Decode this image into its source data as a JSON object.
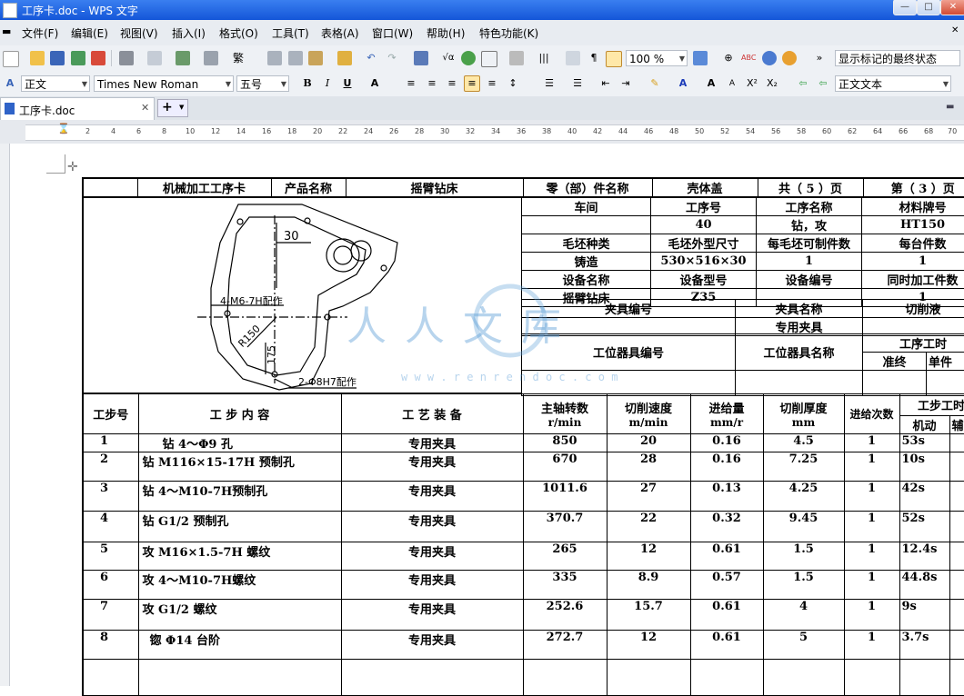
{
  "window": {
    "title": "工序卡.doc - WPS 文字"
  },
  "menu": [
    "文件(F)",
    "编辑(E)",
    "视图(V)",
    "插入(I)",
    "格式(O)",
    "工具(T)",
    "表格(A)",
    "窗口(W)",
    "帮助(H)",
    "特色功能(K)"
  ],
  "toolbar1": {
    "zoom": "100 %",
    "markup_state": "显示标记的最终状态"
  },
  "toolbar2": {
    "style": "正文",
    "font": "Times New Roman",
    "size": "五号",
    "style2": "正文文本"
  },
  "tabs": {
    "doc_tab": "工序卡.doc",
    "add": "+"
  },
  "ruler_ticks": [
    "2",
    "4",
    "6",
    "8",
    "10",
    "12",
    "14",
    "16",
    "18",
    "20",
    "22",
    "24",
    "26",
    "28",
    "30",
    "32",
    "34",
    "36",
    "38",
    "40",
    "42",
    "44",
    "46",
    "48",
    "50",
    "52",
    "54",
    "56",
    "58",
    "60",
    "62",
    "64",
    "66",
    "68",
    "70"
  ],
  "card": {
    "header": {
      "card_title": "机械加工工序卡",
      "product_name_label": "产品名称",
      "product_name": "摇臂钻床",
      "part_name_label": "零（部）件名称",
      "part_name": "壳体盖",
      "total_pages": "共（ 5 ）页",
      "current_page": "第（ 3 ）页"
    },
    "info": {
      "workshop": "车间",
      "process_no_label": "工序号",
      "process_name_label": "工序名称",
      "material_label": "材料牌号",
      "process_no": "40",
      "process_name": "钻，攻",
      "material": "HT150",
      "blank_type_label": "毛坯种类",
      "blank_size_label": "毛坯外型尺寸",
      "per_blank_label": "每毛坯可制件数",
      "per_machine_label": "每台件数",
      "blank_type": "铸造",
      "blank_size": "530×516×30",
      "per_blank": "1",
      "per_machine": "1",
      "equipment_name_label": "设备名称",
      "equipment_model_label": "设备型号",
      "equipment_no_label": "设备编号",
      "simultaneous_label": "同时加工件数",
      "equipment_name": "摇臂钻床",
      "equipment_model": "Z35",
      "simultaneous": "1",
      "fixture_no_label": "夹具编号",
      "fixture_name_label": "夹具名称",
      "coolant_label": "切削液",
      "fixture_name": "专用夹具",
      "station_tool_no_label": "工位器具编号",
      "station_tool_name_label": "工位器具名称",
      "process_time_label": "工序工时",
      "final_label": "准终",
      "unit_label": "单件"
    },
    "drawing": {
      "dim_30": "30",
      "thread": "4-M6-7H配作",
      "radius": "R150",
      "dim_175": "175",
      "pin_hole": "2-Φ8H7配作"
    },
    "steps_header": {
      "step_no": "工步号",
      "content": "工 步 内 容",
      "equipment": "工 艺 装 备",
      "spindle": "主轴转数",
      "spindle_unit": "r/min",
      "speed": "切削速度",
      "speed_unit": "m/min",
      "feed": "进给量",
      "feed_unit": "mm/r",
      "depth": "切削厚度",
      "depth_unit": "mm",
      "passes": "进给次数",
      "step_time": "工步工时",
      "machine": "机动",
      "aux": "辅"
    },
    "steps": [
      {
        "no": "1",
        "content": "钻 4～Φ9 孔",
        "equip": "专用夹具",
        "rpm": "850",
        "speed": "20",
        "feed": "0.16",
        "depth": "4.5",
        "passes": "1",
        "time": "53s"
      },
      {
        "no": "2",
        "content": "钻 M116×15-17H 预制孔",
        "equip": "专用夹具",
        "rpm": "670",
        "speed": "28",
        "feed": "0.16",
        "depth": "7.25",
        "passes": "1",
        "time": "10s"
      },
      {
        "no": "3",
        "content": "钻 4～M10-7H预制孔",
        "equip": "专用夹具",
        "rpm": "1011.6",
        "speed": "27",
        "feed": "0.13",
        "depth": "4.25",
        "passes": "1",
        "time": "42s"
      },
      {
        "no": "4",
        "content": "钻 G1/2 预制孔",
        "equip": "专用夹具",
        "rpm": "370.7",
        "speed": "22",
        "feed": "0.32",
        "depth": "9.45",
        "passes": "1",
        "time": "52s"
      },
      {
        "no": "5",
        "content": "攻 M16×1.5-7H 螺纹",
        "equip": "专用夹具",
        "rpm": "265",
        "speed": "12",
        "feed": "0.61",
        "depth": "1.5",
        "passes": "1",
        "time": "12.4s"
      },
      {
        "no": "6",
        "content": "攻 4～M10-7H螺纹",
        "equip": "专用夹具",
        "rpm": "335",
        "speed": "8.9",
        "feed": "0.57",
        "depth": "1.5",
        "passes": "1",
        "time": "44.8s"
      },
      {
        "no": "7",
        "content": "攻 G1/2 螺纹",
        "equip": "专用夹具",
        "rpm": "252.6",
        "speed": "15.7",
        "feed": "0.61",
        "depth": "4",
        "passes": "1",
        "time": "9s"
      },
      {
        "no": "8",
        "content": "锪 Φ14 台阶",
        "equip": "专用夹具",
        "rpm": "272.7",
        "speed": "12",
        "feed": "0.61",
        "depth": "5",
        "passes": "1",
        "time": "3.7s"
      }
    ]
  },
  "watermark": {
    "text": "人人文库",
    "url": "w w w . r e n r e n d o c . c o m"
  }
}
